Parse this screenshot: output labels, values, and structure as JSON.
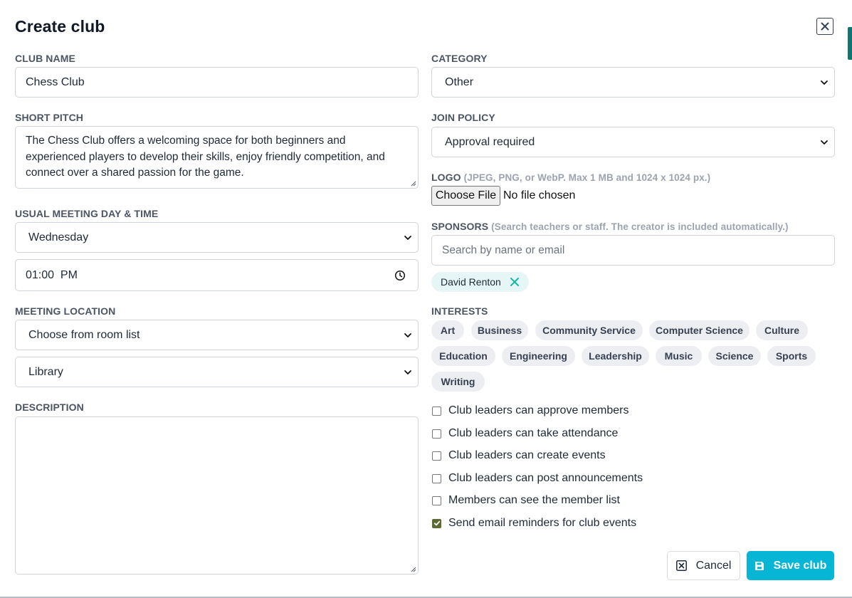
{
  "modal": {
    "title": "Create club"
  },
  "form": {
    "club_name": {
      "label": "CLUB NAME",
      "value": "Chess Club"
    },
    "category": {
      "label": "CATEGORY",
      "selected": "Other"
    },
    "short_pitch": {
      "label": "SHORT PITCH",
      "value": "The Chess Club offers a welcoming space for both beginners and experienced players to develop their skills, enjoy friendly competition, and connect over a shared passion for the game."
    },
    "join_policy": {
      "label": "JOIN POLICY",
      "selected": "Approval required"
    },
    "logo": {
      "label": "LOGO",
      "hint": "(JPEG, PNG, or WebP. Max 1 MB and 1024 x 1024 px.)",
      "button_label": "Choose File",
      "status": "No file chosen"
    },
    "meeting": {
      "label": "USUAL MEETING DAY & TIME",
      "day": "Wednesday",
      "time": "01:00  PM"
    },
    "sponsors": {
      "label": "SPONSORS",
      "hint": "(Search teachers or staff. The creator is included automatically.)",
      "placeholder": "Search by name or email",
      "selected": [
        "David Renton"
      ]
    },
    "location": {
      "label": "MEETING LOCATION",
      "mode": "Choose from room list",
      "room": "Library"
    },
    "interests": {
      "label": "INTERESTS",
      "tags": [
        "Art",
        "Business",
        "Community Service",
        "Computer Science",
        "Culture",
        "Education",
        "Engineering",
        "Leadership",
        "Music",
        "Science",
        "Sports",
        "Writing"
      ]
    },
    "description": {
      "label": "DESCRIPTION",
      "value": ""
    },
    "options": [
      {
        "label": "Club leaders can approve members",
        "checked": false
      },
      {
        "label": "Club leaders can take attendance",
        "checked": false
      },
      {
        "label": "Club leaders can create events",
        "checked": false
      },
      {
        "label": "Club leaders can post announcements",
        "checked": false
      },
      {
        "label": "Members can see the member list",
        "checked": false
      },
      {
        "label": "Send email reminders for club events",
        "checked": true
      }
    ]
  },
  "actions": {
    "cancel_label": "Cancel",
    "save_label": "Save club"
  },
  "colors": {
    "accent": "#06b6d4",
    "checkbox_checked": "#5a6b2f",
    "chip_bg": "#e6f6f7",
    "tag_bg": "#eceef1"
  },
  "icons": {
    "close": "close-icon",
    "chevron": "chevron-down-icon",
    "clock": "clock-icon",
    "remove": "remove-x-icon",
    "cancel": "cancel-x-icon",
    "save": "save-icon"
  }
}
